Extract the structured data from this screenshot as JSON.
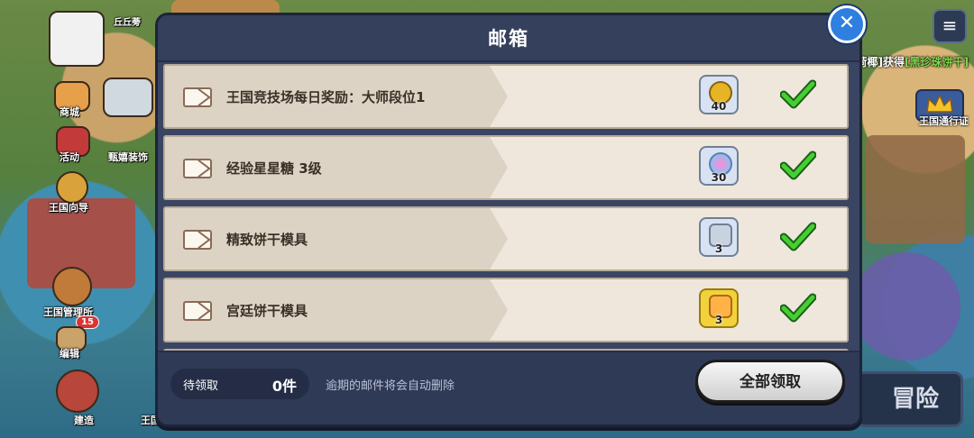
{
  "background": {
    "left_labels": [
      "商城",
      "活动",
      "甄嬉装饰",
      "王国向导",
      "王国管理所",
      "编辑",
      "建造",
      "王国",
      "王国手礼"
    ],
    "player_name": "丘丘蒡",
    "admin_badge": "15",
    "notice_prefix": "[薄荷椰]获得",
    "notice_item": "[黑珍珠饼干]",
    "pass_label": "王国通行证",
    "adventure_label": "冒险",
    "menu_icon": "hamburger-menu-icon"
  },
  "modal": {
    "title": "邮箱",
    "close_icon": "close-icon"
  },
  "mails": [
    {
      "title": "王国竞技场每日奖励：大师段位1",
      "reward_count": "40",
      "reward_icon": "gold-medal-icon",
      "reward_bg": "#d8e2f2"
    },
    {
      "title": "经验星星糖 3级",
      "reward_count": "30",
      "reward_icon": "star-candy-icon",
      "reward_bg": "#d8e2f2"
    },
    {
      "title": "精致饼干模具",
      "reward_count": "3",
      "reward_icon": "cookie-mold-icon",
      "reward_bg": "#d8e2f2"
    },
    {
      "title": "宫廷饼干模具",
      "reward_count": "3",
      "reward_icon": "royal-cookie-mold-icon",
      "reward_bg": "#f2d23a"
    }
  ],
  "footer": {
    "pending_label": "待领取",
    "pending_value": "0件",
    "expire_note": "逾期的邮件将会自动删除",
    "claim_all_label": "全部领取"
  },
  "colors": {
    "modal_bg": "#3a4563",
    "check_green": "#2fb82f",
    "close_blue": "#2f7fe0"
  }
}
